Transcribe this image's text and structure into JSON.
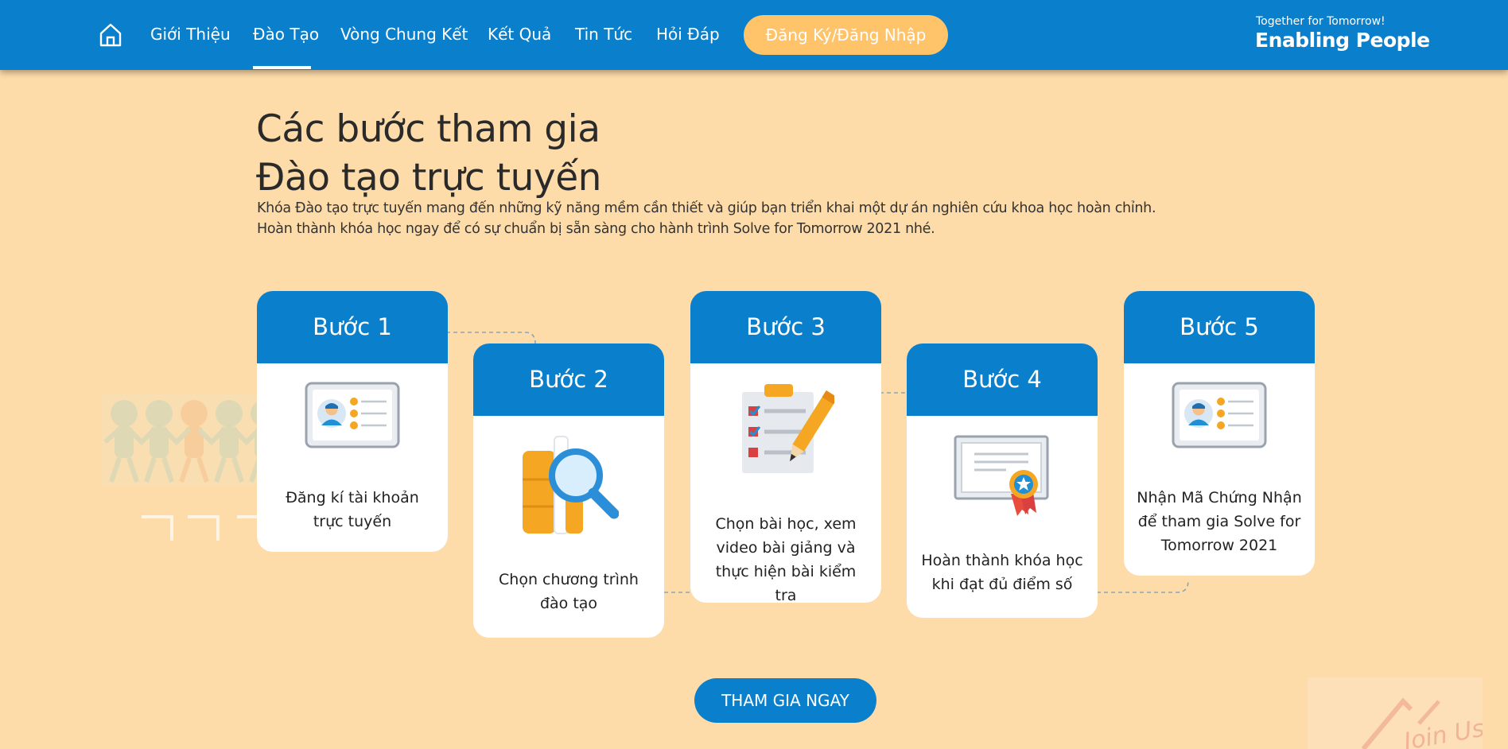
{
  "nav": {
    "items": [
      {
        "label": "Giới Thiệu"
      },
      {
        "label": "Đào Tạo"
      },
      {
        "label": "Vòng Chung Kết"
      },
      {
        "label": "Kết Quả"
      },
      {
        "label": "Tin Tức"
      },
      {
        "label": "Hỏi Đáp"
      }
    ],
    "active": "Đào Tạo",
    "cta_label": "Đăng Ký/Đăng Nhập",
    "brand_tagline": "Together for Tomorrow!",
    "brand_name": "Enabling People"
  },
  "hero": {
    "title_line1": "Các bước tham gia",
    "title_line2": "Đào tạo trực tuyến",
    "desc_line1": "Khóa Đào tạo trực tuyến mang đến những kỹ năng mềm cần thiết và giúp bạn triển khai một dự án nghiên cứu khoa học hoàn chỉnh.",
    "desc_line2": "Hoàn thành khóa học ngay để có sự chuẩn bị sẵn sàng cho hành trình Solve for Tomorrow 2021 nhé."
  },
  "steps": [
    {
      "title": "Bước 1",
      "text": "Đăng kí tài khoản trực tuyến",
      "icon": "id-card-icon"
    },
    {
      "title": "Bước 2",
      "text": "Chọn chương trình đào tạo",
      "icon": "books-magnifier-icon"
    },
    {
      "title": "Bước 3",
      "text": "Chọn bài học, xem video bài giảng và thực hiện bài kiểm tra",
      "icon": "checklist-pencil-icon"
    },
    {
      "title": "Bước 4",
      "text": "Hoàn thành khóa học khi đạt đủ điểm số",
      "icon": "certificate-icon"
    },
    {
      "title": "Bước 5",
      "text": "Nhận Mã Chứng Nhận để tham gia Solve for Tomorrow 2021",
      "icon": "id-card-icon"
    }
  ],
  "cta": {
    "label": "THAM GIA NGAY"
  },
  "decor": {
    "stamp_text": "Join Us"
  },
  "colors": {
    "brand_blue": "#0a7fcb",
    "background": "#fedcaa",
    "cta_orange": "#ffc36a"
  }
}
